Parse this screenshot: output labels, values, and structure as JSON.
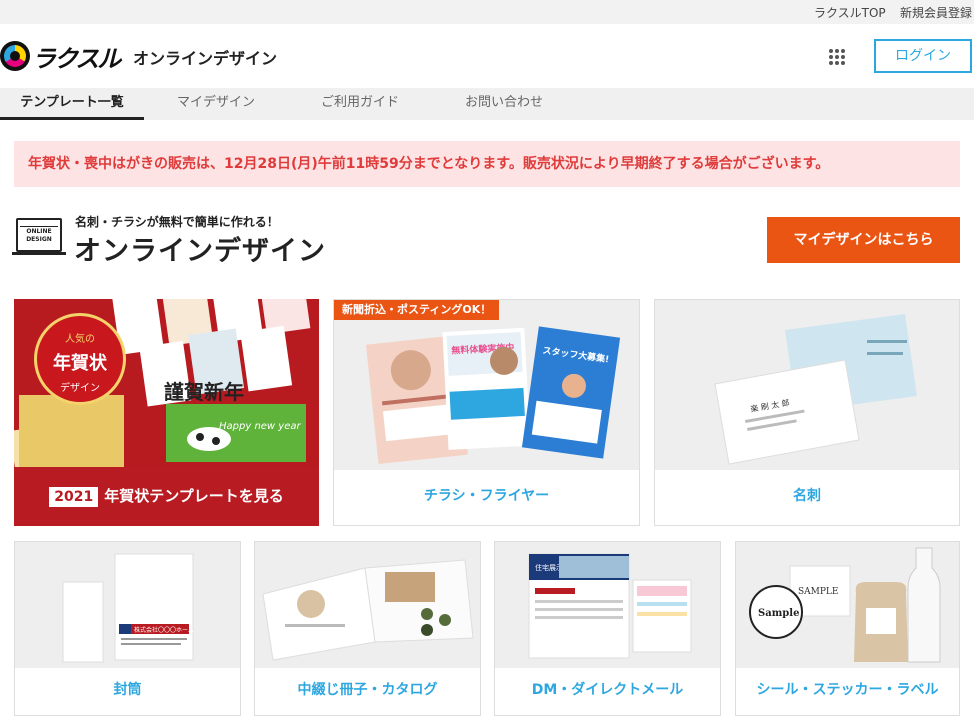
{
  "topbar": {
    "links": [
      "ラクスルTOP",
      "新規会員登録"
    ]
  },
  "header": {
    "logo_text": "ラクスル",
    "site_name": "オンラインデザイン",
    "login_label": "ログイン"
  },
  "nav": {
    "tabs": [
      {
        "label": "テンプレート一覧"
      },
      {
        "label": "マイデザイン"
      },
      {
        "label": "ご利用ガイド"
      },
      {
        "label": "お問い合わせ"
      }
    ]
  },
  "alert": "年賀状・喪中はがきの販売は、12月28日(月)午前11時59分までとなります。販売状況により早期終了する場合がございます。",
  "hero": {
    "badge_line1": "ONLINE",
    "badge_line2": "DESIGN",
    "tagline": "名刺・チラシが無料で簡単に作れる！",
    "title": "オンラインデザイン",
    "mydesign_button": "マイデザインはこちら"
  },
  "cards": {
    "nenga": {
      "year": "2021",
      "label": "年賀状テンプレートを見る",
      "seal_top": "人気の",
      "seal_main": "年賀状",
      "seal_bottom": "デザイン",
      "calligraphy": "謹賀新年",
      "card_text": "Happy new year"
    },
    "flyer": {
      "ribbon": "新聞折込・ポスティングOK！",
      "label": "チラシ・フライヤー",
      "thumb1": "無料体験実施中",
      "thumb2": "スタッフ大募集!"
    },
    "meishi": {
      "label": "名刺",
      "thumb_name": "楽 刷 太 郎"
    },
    "envelope": {
      "label": "封筒",
      "thumb_name": "株式会社〇〇〇ホーム"
    },
    "booklet": {
      "label": "中綴じ冊子・カタログ"
    },
    "dm": {
      "label": "DM・ダイレクトメール",
      "thumb": "住宅展示場"
    },
    "sticker": {
      "label": "シール・ステッカー・ラベル",
      "sample1": "Sample",
      "sample2": "SAMPLE"
    }
  },
  "colors": {
    "brand_blue": "#2ea7e0",
    "cta_orange": "#ea5514",
    "nenga_red": "#b81c22",
    "alert_bg": "#fde3e3",
    "alert_text": "#e03b3b"
  }
}
